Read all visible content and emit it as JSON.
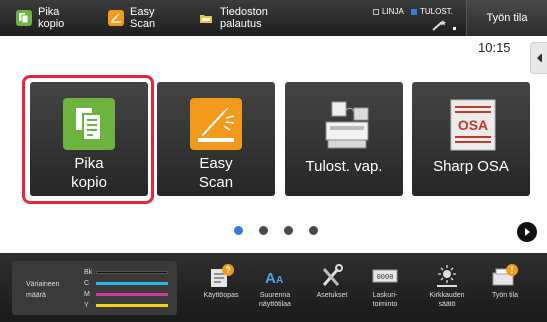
{
  "topbar": {
    "shortcuts": [
      {
        "label": "Pika\nkopio",
        "icon": "copy-icon",
        "color": "#6cb33f"
      },
      {
        "label": "Easy\nScan",
        "icon": "scan-icon",
        "color": "#f39a1c"
      },
      {
        "label": "Tiedoston\npalautus",
        "icon": "folder-icon",
        "color": "#f0c040"
      }
    ],
    "status_linja": "LINJA",
    "status_tulost": "TULOST.",
    "job_status_label": "Työn tila"
  },
  "home": {
    "time": "10:15",
    "tiles": [
      {
        "label": "Pika\nkopio",
        "icon": "copy-icon",
        "selected": true
      },
      {
        "label": "Easy\nScan",
        "icon": "scan-icon"
      },
      {
        "label": "Tulost. vap.",
        "icon": "printer-icon"
      },
      {
        "label": "Sharp OSA",
        "icon": "sharp-osa-icon"
      }
    ],
    "page_dots": {
      "count": 4,
      "active": 1
    }
  },
  "bottombar": {
    "toner": {
      "title": "Väriaineen\nmäärä",
      "rows": [
        {
          "label": "Bk",
          "color": "#111111"
        },
        {
          "label": "C",
          "color": "#2bb6e6"
        },
        {
          "label": "M",
          "color": "#d03a9b"
        },
        {
          "label": "Y",
          "color": "#f2d21b"
        }
      ]
    },
    "buttons": [
      {
        "label": "Käyttöopas",
        "icon": "manual-icon"
      },
      {
        "label": "Suurenna\nnäyttötilaa",
        "icon": "enlarge-text-icon"
      },
      {
        "label": "Asetukset",
        "icon": "settings-tools-icon"
      },
      {
        "label": "Laskuri-\ntoiminto",
        "icon": "counter-icon"
      },
      {
        "label": "Kirkkauden\nsäätö",
        "icon": "brightness-icon"
      },
      {
        "label": "Työn tila",
        "icon": "job-status-icon"
      }
    ]
  },
  "colors": {
    "accent_blue": "#2f7fd6",
    "selection_red": "#e8253a"
  }
}
